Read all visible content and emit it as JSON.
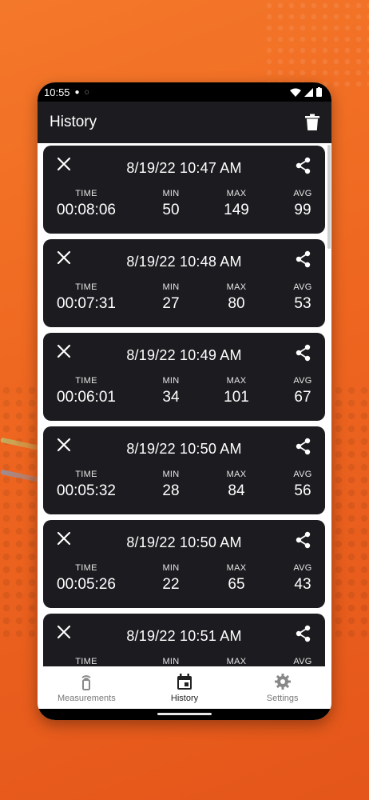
{
  "status": {
    "time": "10:55"
  },
  "appbar": {
    "title": "History"
  },
  "labels": {
    "time": "TIME",
    "min": "MIN",
    "max": "MAX",
    "avg": "AVG"
  },
  "records": [
    {
      "datetime": "8/19/22 10:47 AM",
      "time": "00:08:06",
      "min": "50",
      "max": "149",
      "avg": "99"
    },
    {
      "datetime": "8/19/22 10:48 AM",
      "time": "00:07:31",
      "min": "27",
      "max": "80",
      "avg": "53"
    },
    {
      "datetime": "8/19/22 10:49 AM",
      "time": "00:06:01",
      "min": "34",
      "max": "101",
      "avg": "67"
    },
    {
      "datetime": "8/19/22 10:50 AM",
      "time": "00:05:32",
      "min": "28",
      "max": "84",
      "avg": "56"
    },
    {
      "datetime": "8/19/22 10:50 AM",
      "time": "00:05:26",
      "min": "22",
      "max": "65",
      "avg": "43"
    },
    {
      "datetime": "8/19/22 10:51 AM",
      "time": "",
      "min": "",
      "max": "",
      "avg": ""
    }
  ],
  "nav": [
    {
      "label": "Measurements",
      "icon": "sensor-icon",
      "active": false
    },
    {
      "label": "History",
      "icon": "calendar-icon",
      "active": true
    },
    {
      "label": "Settings",
      "icon": "gear-icon",
      "active": false
    }
  ],
  "colors": {
    "background": "#ee6620",
    "card": "#1c1b1f",
    "appbar": "#1c1b1f"
  }
}
